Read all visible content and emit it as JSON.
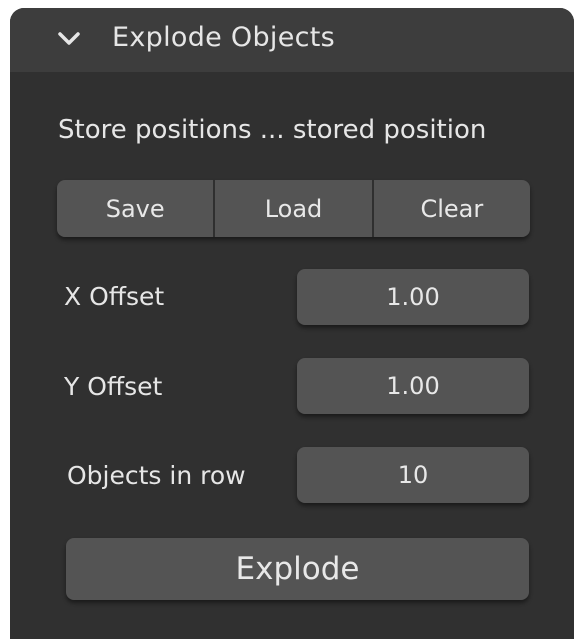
{
  "panel": {
    "title": "Explode Objects",
    "expanded_icon": "chevron-down-icon"
  },
  "info": {
    "text": "Store positions ... stored position"
  },
  "position_buttons": {
    "save_label": "Save",
    "load_label": "Load",
    "clear_label": "Clear"
  },
  "fields": {
    "x_offset": {
      "label": "X Offset",
      "value": "1.00"
    },
    "y_offset": {
      "label": "Y Offset",
      "value": "1.00"
    },
    "objects_in_row": {
      "label": "Objects in row",
      "value": "10"
    }
  },
  "explode_button": {
    "label": "Explode"
  },
  "colors": {
    "panel_bg": "#303030",
    "header_bg": "#3d3d3d",
    "button_bg": "#545454",
    "text": "#e6e6e6"
  }
}
